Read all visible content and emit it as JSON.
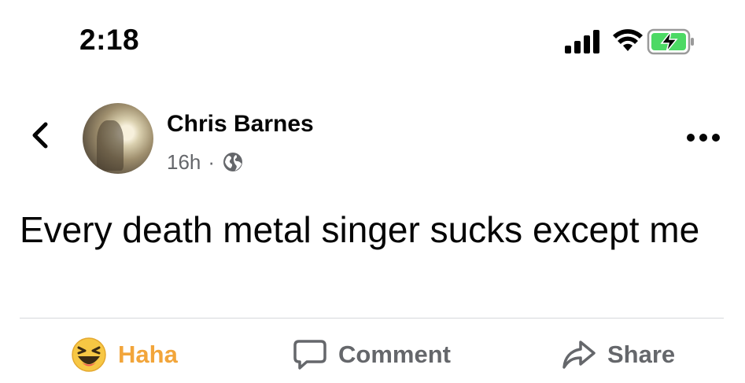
{
  "status_bar": {
    "time": "2:18",
    "signal_icon": "cellular-signal-icon",
    "wifi_icon": "wifi-icon",
    "battery_icon": "battery-charging-icon",
    "battery_color": "#4cd964"
  },
  "header": {
    "back_icon": "chevron-left-icon",
    "author_name": "Chris Barnes",
    "timestamp": "16h",
    "separator": "·",
    "audience_icon": "globe-icon",
    "more_icon": "more-horizontal-icon"
  },
  "post": {
    "text": "Every death metal singer sucks except me"
  },
  "actions": {
    "haha": {
      "label": "Haha",
      "icon": "haha-emoji-icon",
      "color": "#f2a53a"
    },
    "comment": {
      "label": "Comment",
      "icon": "comment-bubble-icon"
    },
    "share": {
      "label": "Share",
      "icon": "share-arrow-icon"
    }
  },
  "colors": {
    "text_primary": "#050505",
    "text_secondary": "#65676b",
    "divider": "#d6d8dc"
  }
}
